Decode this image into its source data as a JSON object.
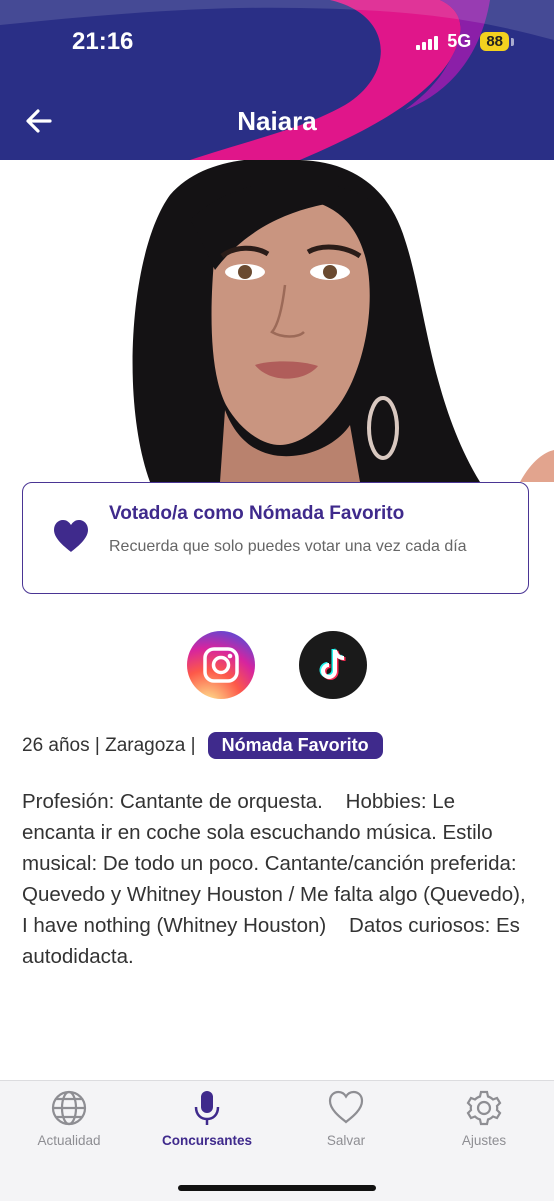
{
  "status_bar": {
    "time": "21:16",
    "network": "5G",
    "battery": "88"
  },
  "header": {
    "title": "Naiara",
    "back_icon": "arrow-left-icon"
  },
  "colors": {
    "header_bg": "#2a2f86",
    "accent": "#3f2a8c",
    "swoosh": "#e0168a",
    "battery": "#f3d11f"
  },
  "vote_card": {
    "title": "Votado/a como Nómada Favorito",
    "subtitle": "Recuerda que solo puedes votar una vez cada día",
    "icon": "heart-icon"
  },
  "social": [
    {
      "name": "instagram",
      "icon": "instagram-icon"
    },
    {
      "name": "tiktok",
      "icon": "tiktok-icon"
    }
  ],
  "meta": {
    "info": "26 años | Zaragoza |",
    "badge": "Nómada Favorito"
  },
  "bio": "Profesión: Cantante de orquesta.    Hobbies: Le encanta ir en coche sola escuchando música. Estilo musical: De todo un poco. Cantante/canción preferida: Quevedo y Whitney Houston / Me falta algo (Quevedo), I have nothing (Whitney Houston)    Datos curiosos: Es autodidacta.",
  "tabs": [
    {
      "label": "Actualidad",
      "icon": "globe-icon",
      "active": false
    },
    {
      "label": "Concursantes",
      "icon": "microphone-icon",
      "active": true
    },
    {
      "label": "Salvar",
      "icon": "heart-outline-icon",
      "active": false
    },
    {
      "label": "Ajustes",
      "icon": "gear-icon",
      "active": false
    }
  ]
}
